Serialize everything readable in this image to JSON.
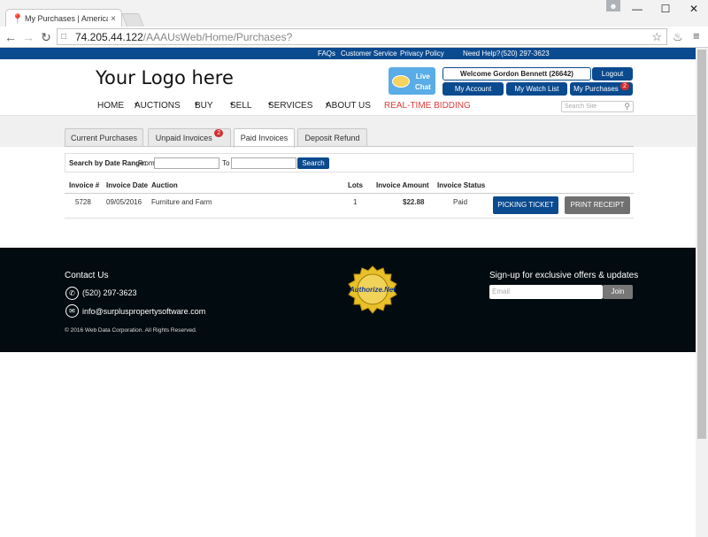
{
  "browser": {
    "tab_title": "My Purchases | American",
    "tab_close": "×",
    "url_host": "74.205.44.122",
    "url_path": "/AAAUsWeb/Home/Purchases?",
    "win_min": "—",
    "win_max": "☐",
    "win_close": "✕"
  },
  "topbar": {
    "faqs": "FAQs",
    "customer_service": "Customer Service",
    "privacy_policy": "Privacy Policy",
    "need_help": "Need Help?",
    "phone": "(520) 297-3623"
  },
  "header": {
    "logo_text": "Your Logo here",
    "live_chat_line1": "Live",
    "live_chat_line2": "Chat",
    "welcome": "Welcome Gordon Bennett (26642)",
    "logout": "Logout",
    "my_account": "My Account",
    "my_watch_list": "My Watch List",
    "my_purchases": "My Purchases",
    "my_purchases_badge": "2"
  },
  "nav": {
    "items": [
      "HOME",
      "AUCTIONS",
      "BUY",
      "SELL",
      "SERVICES",
      "ABOUT US",
      "REAL-TIME BIDDING"
    ],
    "caret": "▾",
    "search_placeholder": "Search Site"
  },
  "tabs": {
    "items": [
      "Current Purchases",
      "Unpaid Invoices",
      "Paid Invoices",
      "Deposit Refund"
    ],
    "unpaid_badge": "2",
    "active": "Paid Invoices"
  },
  "filter": {
    "label": "Search by Date Range:",
    "from": "From",
    "to": "To",
    "search_button": "Search"
  },
  "invoices": {
    "headers": [
      "Invoice #",
      "Invoice Date",
      "Auction",
      "Lots",
      "Invoice Amount",
      "Invoice Status"
    ],
    "rows": [
      {
        "number": "5728",
        "date": "09/05/2016",
        "auction": "Furniture and Farm",
        "lots": "1",
        "amount": "$22.88",
        "status": "Paid",
        "picking_ticket": "PICKING TICKET",
        "print_receipt": "PRINT RECEIPT"
      }
    ]
  },
  "footer": {
    "contact_title": "Contact Us",
    "phone": "(520) 297-3623",
    "email": "info@surpluspropertysoftware.com",
    "copyright": "© 2016 Web Data Corporation. All Rights Reserved.",
    "seal_text": "Authorize.Net",
    "signup_title": "Sign-up for exclusive offers & updates",
    "email_placeholder": "Email",
    "join": "Join"
  },
  "colors": {
    "brand_blue": "#0a4a8f",
    "badge_red": "#d32f2f",
    "realtime_red": "#e03c3c",
    "footer_bg": "#020b0f"
  }
}
